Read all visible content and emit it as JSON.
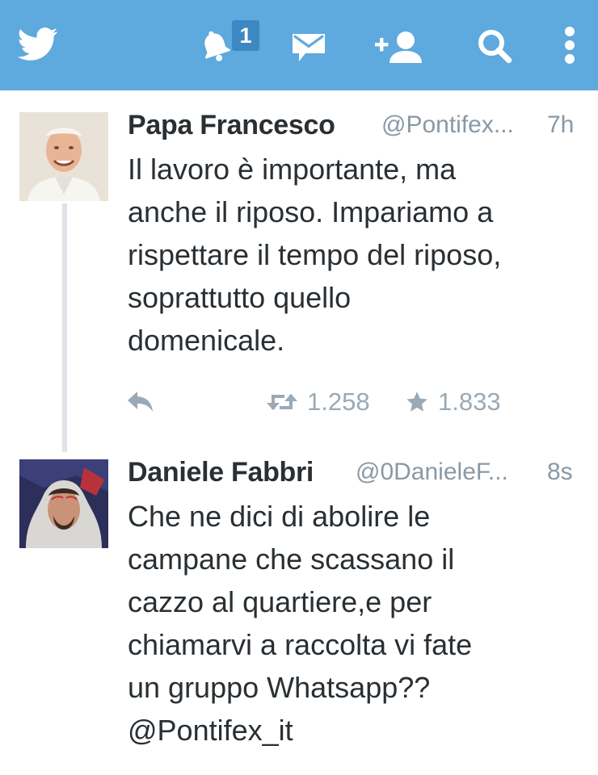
{
  "app": {
    "topbar_color": "#5ea9dd",
    "icons": [
      "twitter-bird-icon",
      "notifications-bell-icon",
      "messages-envelope-icon",
      "add-user-icon",
      "search-icon",
      "more-options-icon"
    ],
    "notification_count": "1"
  },
  "tweets": [
    {
      "name": "Papa Francesco",
      "handle": "@Pontifex...",
      "time": "7h",
      "text_lines": [
        "Il lavoro è importante, ma",
        "anche il riposo. Impariamo a",
        "rispettare il tempo del riposo,",
        "soprattutto quello",
        "domenicale."
      ],
      "retweets": "1.258",
      "favorites": "1.833"
    },
    {
      "name": "Daniele Fabbri",
      "handle": "@0DanieleF...",
      "time": "8s",
      "text_lines": [
        "Che ne dici di abolire le",
        "campane che scassano il",
        "cazzo al quartiere,e per",
        "chiamarvi a raccolta vi fate",
        "un gruppo Whatsapp??",
        "@Pontifex_it"
      ]
    }
  ]
}
